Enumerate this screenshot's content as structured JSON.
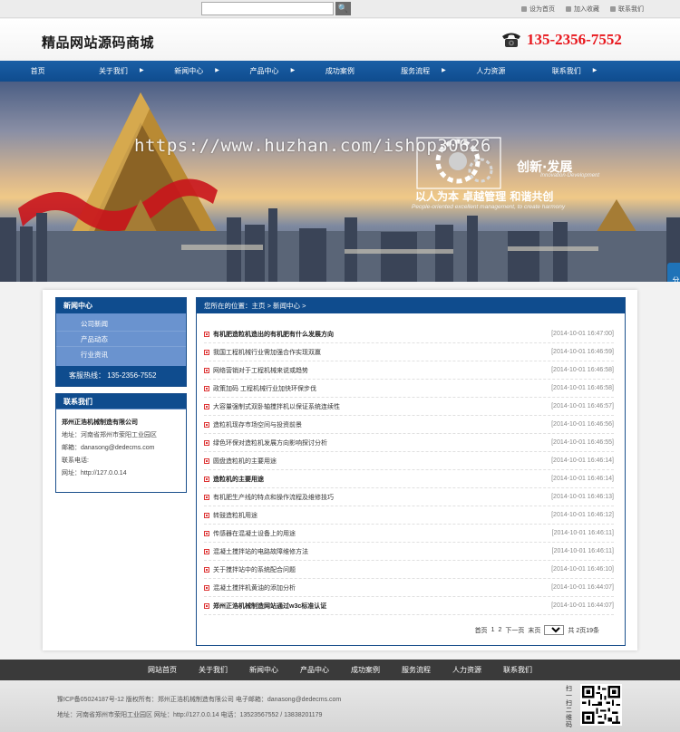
{
  "topbar": {
    "search_placeholder": "",
    "search_button": "🔍",
    "links": [
      "设为首页",
      "加入收藏",
      "联系我们"
    ]
  },
  "header": {
    "logo": "精品网站源码商城",
    "phone": "135-2356-7552"
  },
  "nav": [
    {
      "label": "首页",
      "has_arrow": false
    },
    {
      "label": "关于我们",
      "has_arrow": true
    },
    {
      "label": "新闻中心",
      "has_arrow": true
    },
    {
      "label": "产品中心",
      "has_arrow": true
    },
    {
      "label": "成功案例",
      "has_arrow": false
    },
    {
      "label": "服务流程",
      "has_arrow": true
    },
    {
      "label": "人力资源",
      "has_arrow": false
    },
    {
      "label": "联系我们",
      "has_arrow": true
    }
  ],
  "banner": {
    "watermark": "https://www.huzhan.com/ishop30626",
    "slogan_a": "创新·发展",
    "slogan_a_en": "Innovation·Development",
    "slogan_b": "以人为本 卓越管理 和谐共创",
    "slogan_b_en": "People-oriented excellent management, to create harmony",
    "share": "分享到"
  },
  "sidebar": {
    "news_title": "新闻中心",
    "news_items": [
      "公司新闻",
      "产品动态",
      "行业资讯"
    ],
    "hotline": "客服热线：   135-2356-7552",
    "contact_title": "联系我们",
    "contact_lines": [
      "郑州正浩机械制造有限公司",
      "地址：河南省郑州市荥阳工业园区",
      "邮箱：danasong@dedecms.com",
      "联系电话:",
      "网址：http://127.0.0.14"
    ]
  },
  "content": {
    "breadcrumb": "您所在的位置：主页 > 新闻中心 >",
    "news": [
      {
        "title": "有机肥造粒机造出的有机肥有什么发展方向",
        "date": "[2014-10-01 16:47:00]",
        "strong": true
      },
      {
        "title": "我国工程机械行业需加强合作实现双赢",
        "date": "[2014-10-01 16:46:59]",
        "strong": false
      },
      {
        "title": "网络营销对于工程机械来说或趋势",
        "date": "[2014-10-01 16:46:58]",
        "strong": false
      },
      {
        "title": "政策加码 工程机械行业加快环保步伐",
        "date": "[2014-10-01 16:46:58]",
        "strong": false
      },
      {
        "title": "大容量强制式双卧轴搅拌机以保证系统连续性",
        "date": "[2014-10-01 16:46:57]",
        "strong": false
      },
      {
        "title": "造粒机现存市场空间与投资前景",
        "date": "[2014-10-01 16:46:56]",
        "strong": false
      },
      {
        "title": "绿色环保对造粒机发展方向影响探讨分析",
        "date": "[2014-10-01 16:46:55]",
        "strong": false
      },
      {
        "title": "圆盘造粒机的主要用途",
        "date": "[2014-10-01 16:46:14]",
        "strong": false
      },
      {
        "title": "造粒机的主要用途",
        "date": "[2014-10-01 16:46:14]",
        "strong": true
      },
      {
        "title": "有机肥生产线的特点和操作流程及维修技巧",
        "date": "[2014-10-01 16:46:13]",
        "strong": false
      },
      {
        "title": "转鼓造粒机用途",
        "date": "[2014-10-01 16:46:12]",
        "strong": false
      },
      {
        "title": "传感器在混凝土设备上的用途",
        "date": "[2014-10-01 16:46:11]",
        "strong": false
      },
      {
        "title": "混凝土搅拌站的电路故障维修方法",
        "date": "[2014-10-01 16:46:11]",
        "strong": false
      },
      {
        "title": "关于搅拌站中的系统配合问题",
        "date": "[2014-10-01 16:46:10]",
        "strong": false
      },
      {
        "title": "混凝土搅拌机黄油的添加分析",
        "date": "[2014-10-01 16:44:07]",
        "strong": false
      },
      {
        "title": "郑州正浩机械制造网站通过w3c标准认证",
        "date": "[2014-10-01 16:44:07]",
        "strong": true
      }
    ],
    "pager": {
      "first": "首页",
      "pages": [
        "1",
        "2"
      ],
      "next": "下一页",
      "last": "末页",
      "select_value": "1",
      "summary": "共 2页19条"
    }
  },
  "footer": {
    "nav": [
      "网站首页",
      "关于我们",
      "新闻中心",
      "产品中心",
      "成功案例",
      "服务流程",
      "人力资源",
      "联系我们"
    ],
    "line1": "豫ICP备05024187号-12 版权所有：郑州正浩机械制造有限公司  电子邮箱：danasong@dedecms.com",
    "line2": "地址：河南省郑州市荥阳工业园区  网址：http://127.0.0.14  电话：13523567552 / 13838201179",
    "qr_label": "扫一扫二维码"
  }
}
